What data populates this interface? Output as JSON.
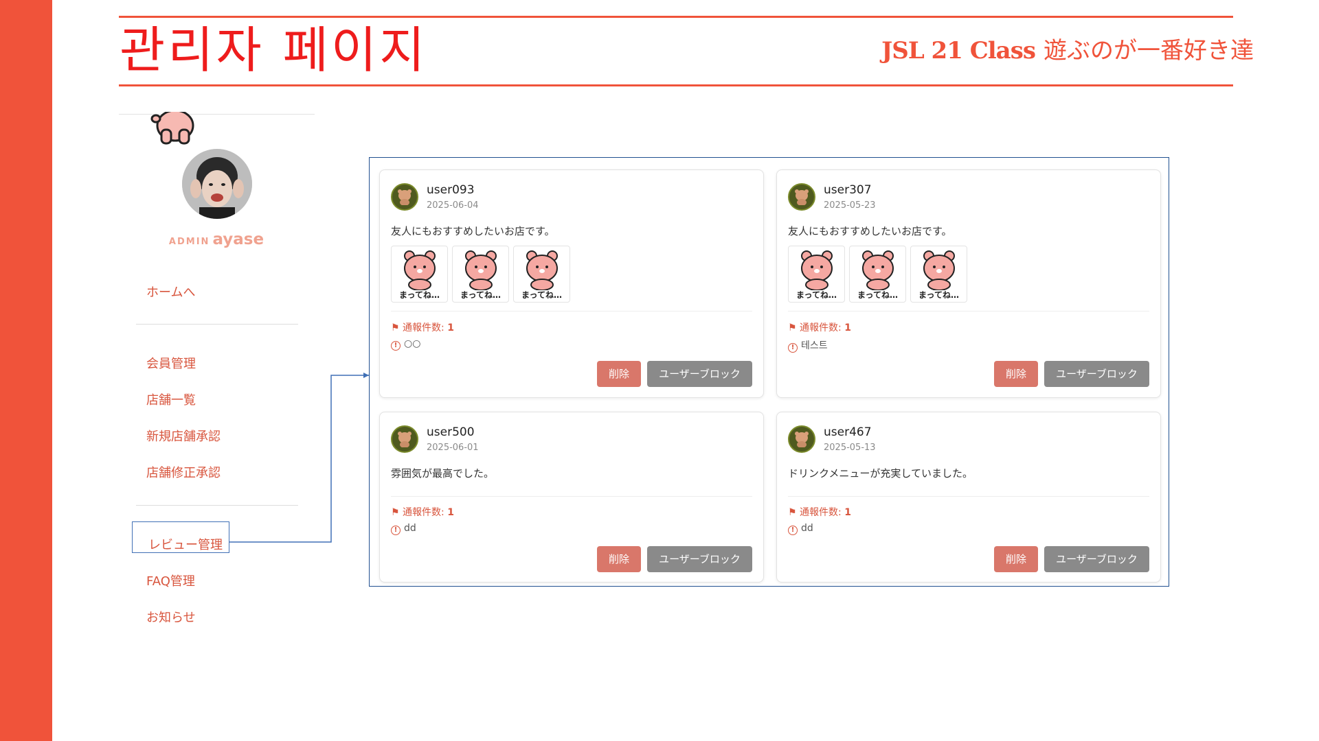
{
  "header": {
    "title": "관리자 페이지",
    "brand": "JSL 21 Class",
    "tagline": "遊ぶのが一番好き達"
  },
  "colors": {
    "accent": "#f0533a",
    "title_red": "#ee1c1c",
    "nav_text": "#d8553d",
    "delete_button": "#d9776a",
    "block_button": "#8a8a8a",
    "highlight_border": "#3f6fb5"
  },
  "sidebar": {
    "admin_tag": "ADMIN",
    "admin_name": "ayase",
    "items": [
      {
        "label": "ホームへ"
      },
      {
        "label": "会員管理"
      },
      {
        "label": "店舗一覧"
      },
      {
        "label": "新規店舗承認"
      },
      {
        "label": "店舗修正承認"
      },
      {
        "label": "レビュー管理",
        "active": true
      },
      {
        "label": "FAQ管理"
      },
      {
        "label": "お知らせ"
      }
    ]
  },
  "reviews": [
    {
      "user": "user093",
      "date": "2025-06-04",
      "comment": "友人にもおすすめしたいお店です。",
      "images": [
        {
          "label": "まってね…"
        },
        {
          "label": "まってね…"
        },
        {
          "label": "まってね…"
        }
      ],
      "report_label": "通報件数:",
      "report_count": "1",
      "reason": "○○",
      "delete_label": "削除",
      "block_label": "ユーザーブロック"
    },
    {
      "user": "user307",
      "date": "2025-05-23",
      "comment": "友人にもおすすめしたいお店です。",
      "images": [
        {
          "label": "まってね…"
        },
        {
          "label": "まってね…"
        },
        {
          "label": "まってね…"
        }
      ],
      "report_label": "通報件数:",
      "report_count": "1",
      "reason": "테스트",
      "delete_label": "削除",
      "block_label": "ユーザーブロック"
    },
    {
      "user": "user500",
      "date": "2025-06-01",
      "comment": "雰囲気が最高でした。",
      "images": [],
      "report_label": "通報件数:",
      "report_count": "1",
      "reason": "dd",
      "delete_label": "削除",
      "block_label": "ユーザーブロック"
    },
    {
      "user": "user467",
      "date": "2025-05-13",
      "comment": "ドリンクメニューが充実していました。",
      "images": [],
      "report_label": "通報件数:",
      "report_count": "1",
      "reason": "dd",
      "delete_label": "削除",
      "block_label": "ユーザーブロック"
    }
  ]
}
